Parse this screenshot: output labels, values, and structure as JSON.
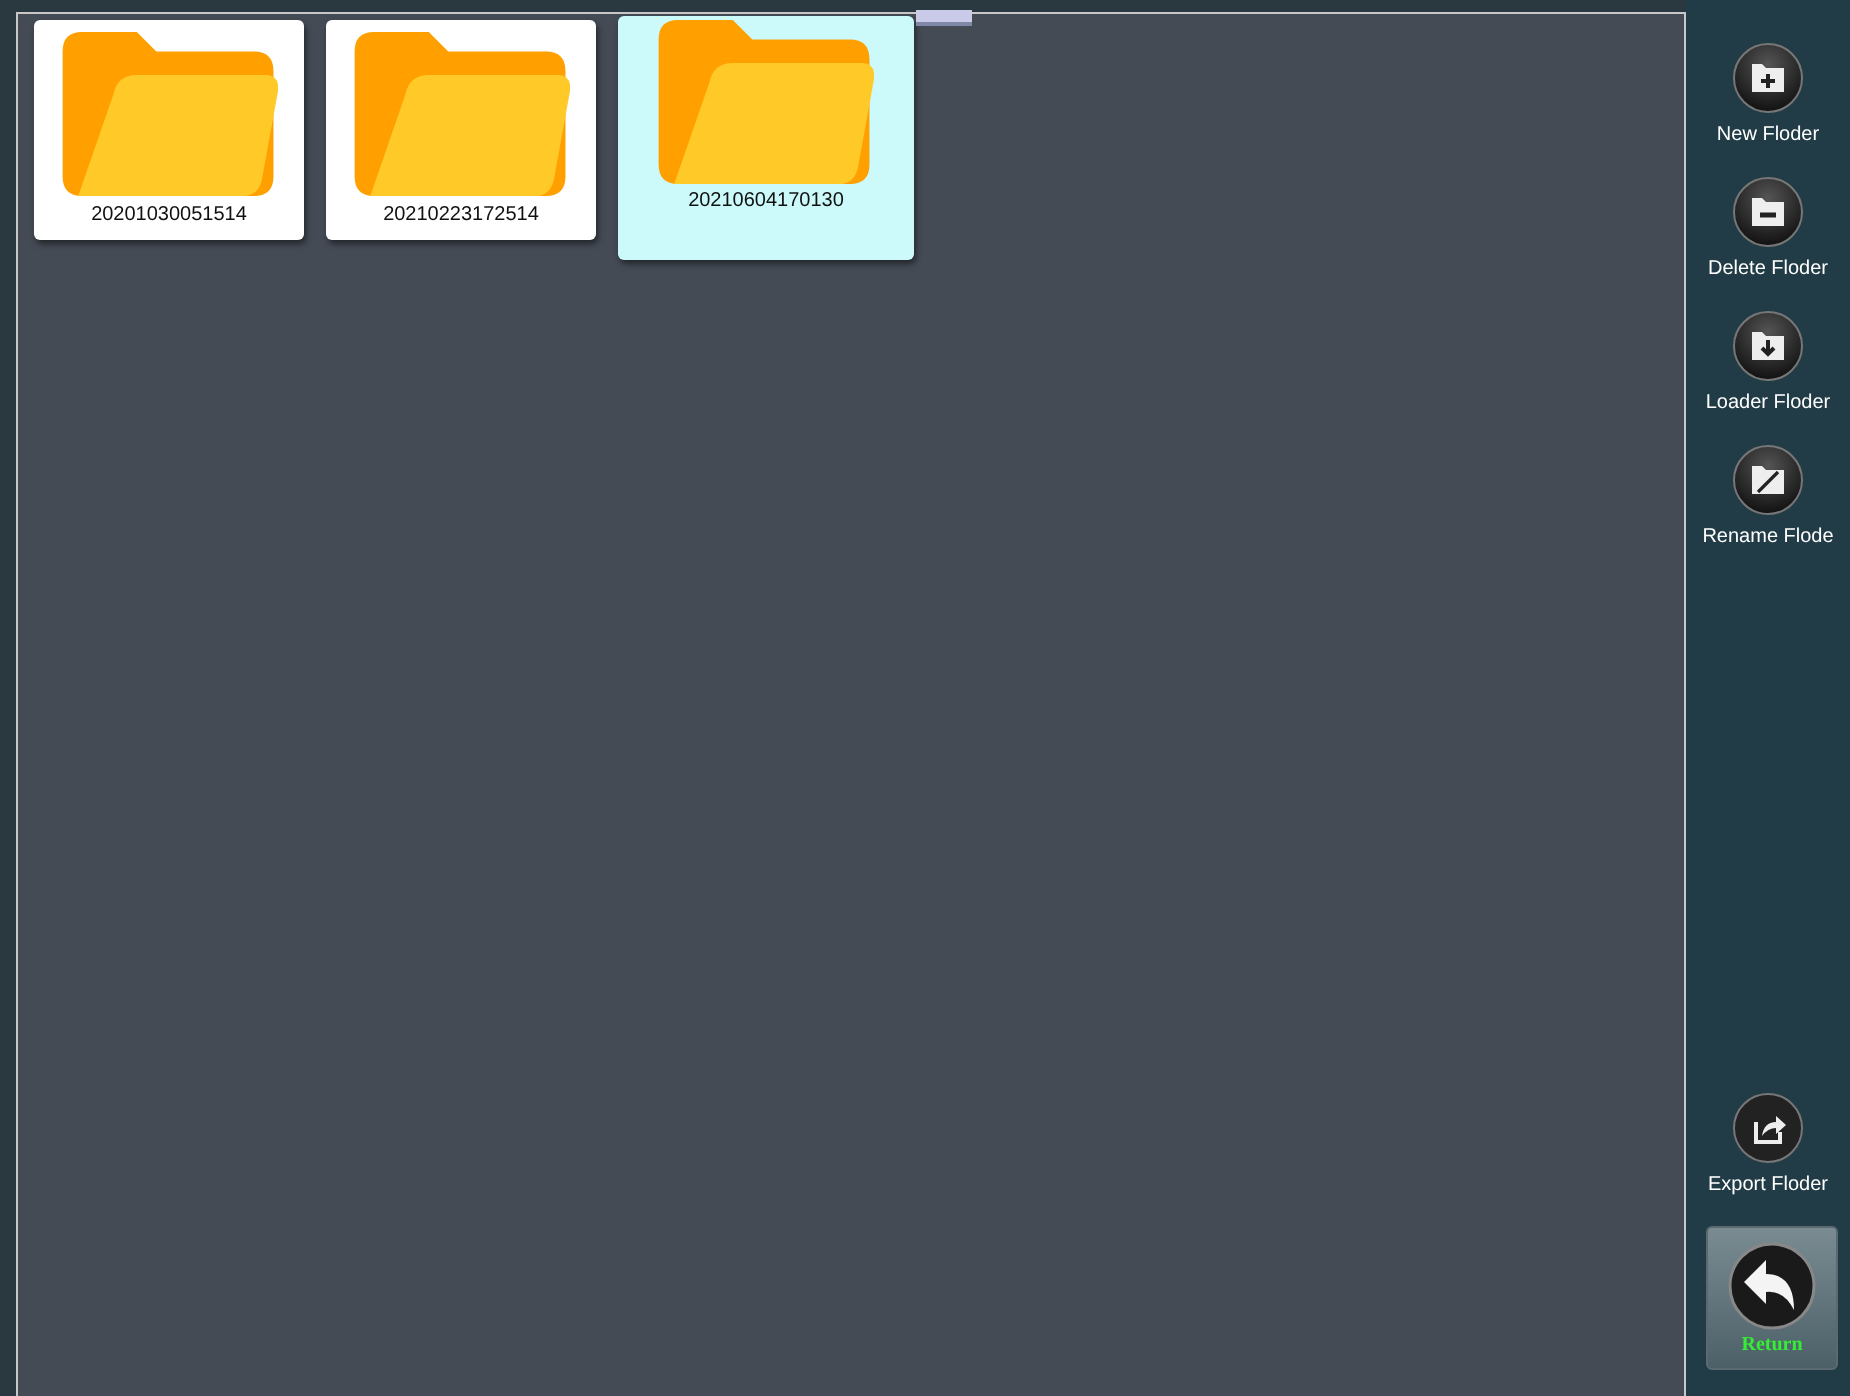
{
  "folders": [
    {
      "name": "20201030051514",
      "selected": false
    },
    {
      "name": "20210223172514",
      "selected": false
    },
    {
      "name": "20210604170130",
      "selected": true
    }
  ],
  "actions": [
    {
      "kind": "new",
      "label": "New Floder"
    },
    {
      "kind": "delete",
      "label": "Delete Floder"
    },
    {
      "kind": "load",
      "label": "Loader Floder"
    },
    {
      "kind": "rename",
      "label": "Rename Flode"
    }
  ],
  "bottom_actions": [
    {
      "kind": "export",
      "label": "Export Floder"
    }
  ],
  "return_button": {
    "label": "Return"
  }
}
